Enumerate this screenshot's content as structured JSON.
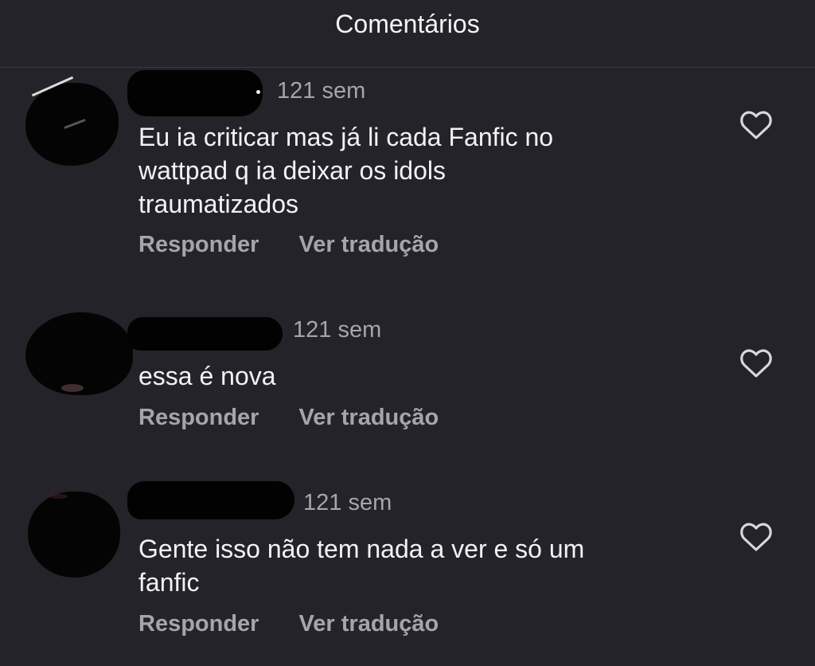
{
  "header": {
    "title": "Comentários"
  },
  "comments": [
    {
      "time": "121 sem",
      "text_lines": [
        "Eu ia criticar mas já li cada Fanfic no",
        "wattpad q ia deixar os idols",
        "traumatizados"
      ],
      "reply_label": "Responder",
      "translate_label": "Ver tradução"
    },
    {
      "time": "121 sem",
      "text_lines": [
        "essa é nova"
      ],
      "reply_label": "Responder",
      "translate_label": "Ver tradução"
    },
    {
      "time": "121 sem",
      "text_lines": [
        "Gente isso não tem nada a ver e só um",
        "fanfic"
      ],
      "reply_label": "Responder",
      "translate_label": "Ver tradução"
    }
  ],
  "icons": {
    "like": "heart-outline-icon"
  },
  "colors": {
    "background": "#24232a",
    "text": "#f2f2f4",
    "secondary": "#a5a5ae",
    "divider": "#3a3941",
    "redaction": "#020202"
  }
}
